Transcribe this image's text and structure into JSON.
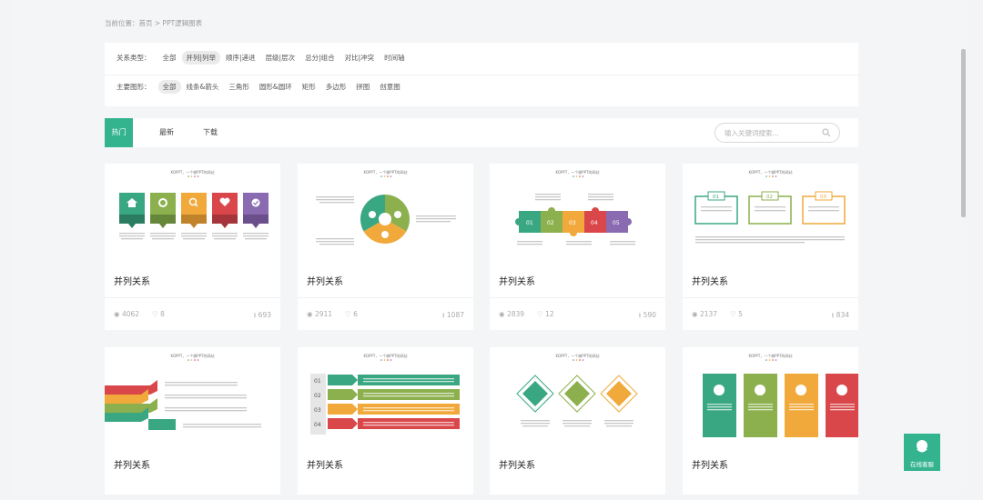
{
  "breadcrumb": "当前位置：首页 > PPT逻辑图表",
  "filters": {
    "relation_label": "关系类型：",
    "relation_options": [
      "全部",
      "并列|列举",
      "顺序|递进",
      "层级|层次",
      "总分|组合",
      "对比|冲突",
      "时间轴"
    ],
    "relation_active": "并列|列举",
    "shape_label": "主要图形：",
    "shape_options": [
      "全部",
      "线条&箭头",
      "三角形",
      "圆形&圆环",
      "矩形",
      "多边形",
      "拼图",
      "创意图"
    ],
    "shape_active": "全部"
  },
  "tabs": [
    "热门",
    "最新",
    "下载"
  ],
  "search": {
    "placeholder": "输入关键词搜索..."
  },
  "thumb_brand": "KOPPT，一个做PPT的网站",
  "cards": [
    {
      "title": "并列关系",
      "views": "4062",
      "likes": "8",
      "downloads": "693"
    },
    {
      "title": "并列关系",
      "views": "2911",
      "likes": "6",
      "downloads": "1087"
    },
    {
      "title": "并列关系",
      "views": "2839",
      "likes": "12",
      "downloads": "590"
    },
    {
      "title": "并列关系",
      "views": "2137",
      "likes": "5",
      "downloads": "834"
    },
    {
      "title": "并列关系"
    },
    {
      "title": "并列关系"
    },
    {
      "title": "并列关系"
    },
    {
      "title": "并列关系"
    }
  ],
  "thumb_labels": {
    "num_boxes": [
      "01",
      "02",
      "03"
    ],
    "rows": [
      "01",
      "02",
      "03",
      "04"
    ],
    "puzzle": [
      "01",
      "02",
      "03",
      "04",
      "05"
    ]
  },
  "online_service": "在线客服",
  "colors": {
    "accent": "#34b38f",
    "green": "#3aa783",
    "olive": "#8cb04d",
    "orange": "#f0a93a",
    "red": "#d9474b",
    "purple": "#8a6bb1"
  }
}
